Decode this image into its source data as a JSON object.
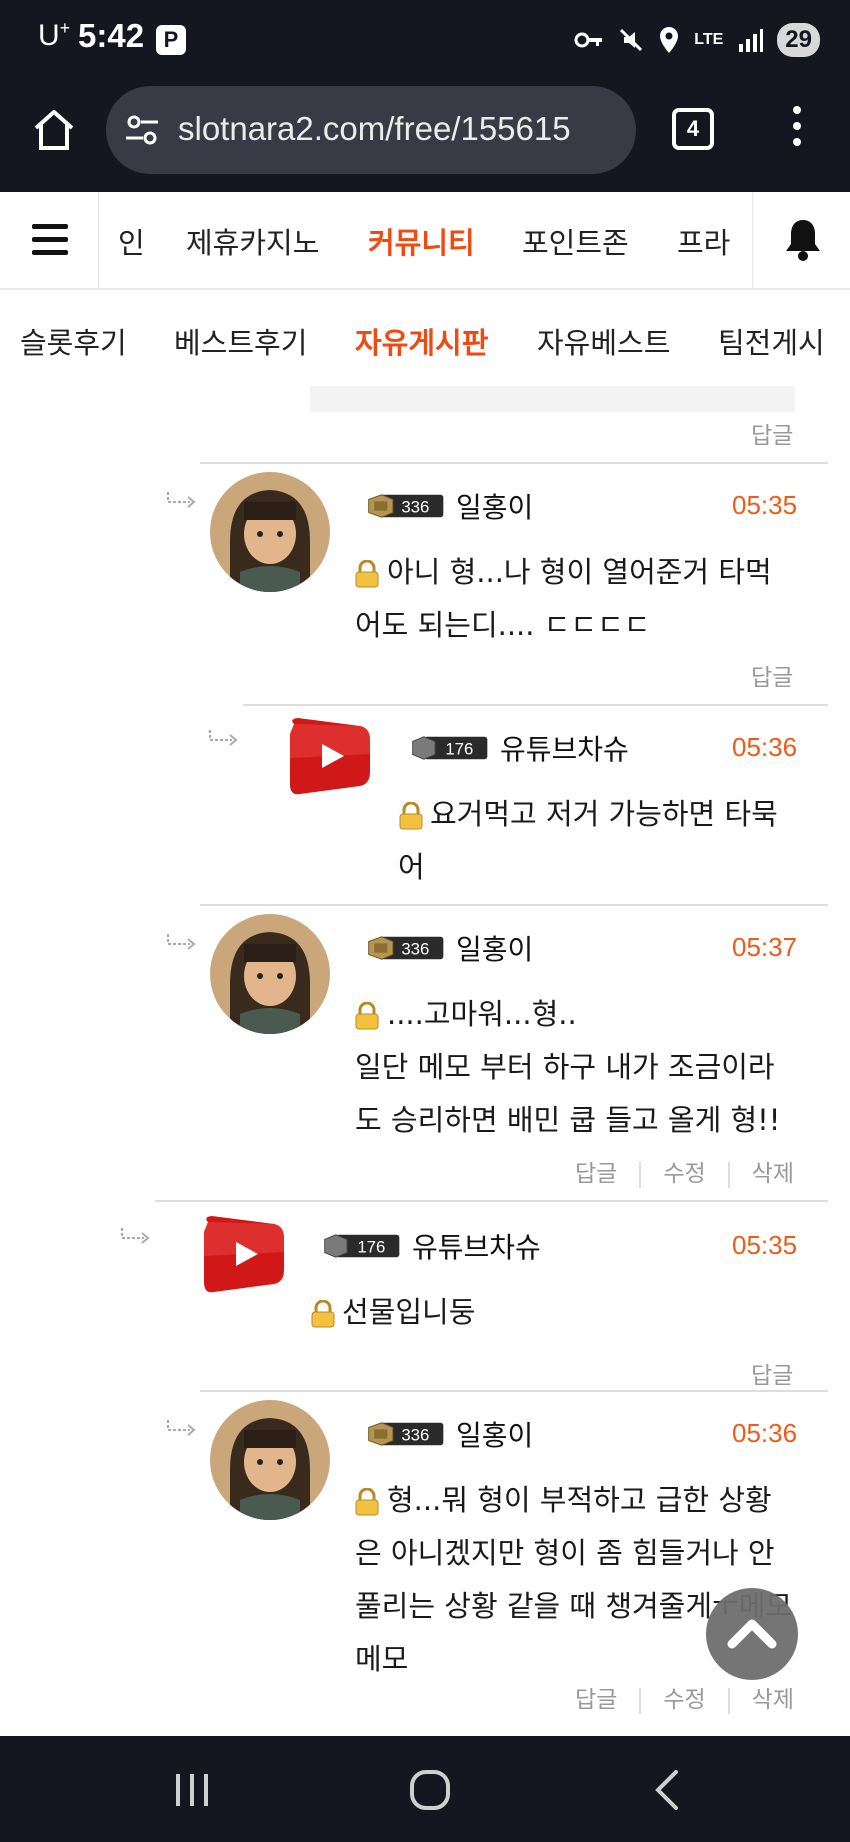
{
  "status": {
    "carrier": "U",
    "carrier_sup": "+",
    "time": "5:42",
    "pbadge": "P",
    "lte": "LTE",
    "battery": "29"
  },
  "browser": {
    "url": "slotnara2.com/free/155615",
    "tabs": "4"
  },
  "nav": {
    "items": [
      "인",
      "제휴카지노",
      "커뮤니티",
      "포인트존",
      "프라"
    ],
    "active": 2
  },
  "subnav": {
    "items": [
      "슬롯후기",
      "베스트후기",
      "자유게시판",
      "자유베스트",
      "팀전게시"
    ],
    "active": 2
  },
  "labels": {
    "reply": "답글",
    "edit": "수정",
    "delete": "삭제"
  },
  "comments": [
    {
      "user": "일홍이",
      "level": "336",
      "time": "05:35",
      "text": "아니 형...나 형이 열어준거 타먹어도 되는디.... ㄷㄷㄷㄷ"
    },
    {
      "user": "유튜브차슈",
      "level": "176",
      "time": "05:36",
      "text": "요거먹고 저거 가능하면 타묵어"
    },
    {
      "user": "일홍이",
      "level": "336",
      "time": "05:37",
      "text": "....고마워...형..",
      "text2": "일단 메모 부터 하구 내가 조금이라도 승리하면 배민 쿱 들고 올게 형!!"
    },
    {
      "user": "유튜브차슈",
      "level": "176",
      "time": "05:35",
      "text": "선물입니둥"
    },
    {
      "user": "일홍이",
      "level": "336",
      "time": "05:36",
      "text": "형...뭐 형이 부적하고 급한 상황은 아니겠지만 형이 좀 힘들거나 안 풀리는 상황 같을 때 챙겨줄게ㅜ메모 메모"
    }
  ],
  "icons": {
    "home": "home-icon",
    "tune": "tune-icon",
    "menu": "hamburger-icon",
    "bell": "bell-icon",
    "lock": "lock-icon",
    "scroll_top": "chevron-up-icon"
  },
  "colors": {
    "accent": "#f04a10",
    "time": "#f05a18",
    "chrome": "#161621"
  }
}
